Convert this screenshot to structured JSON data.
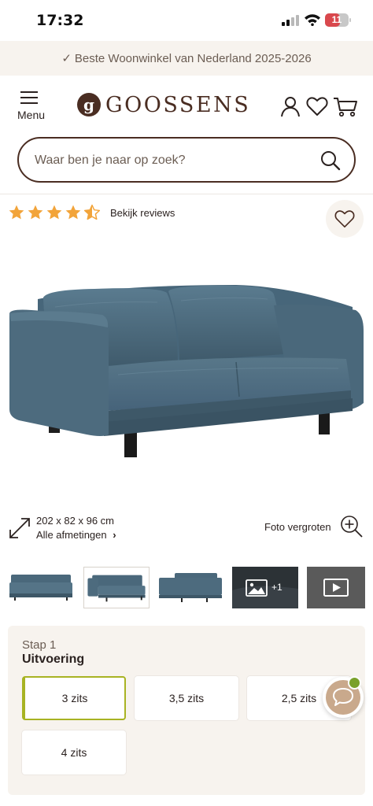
{
  "status_bar": {
    "time": "17:32",
    "battery": "11"
  },
  "announcement": {
    "check": "✓",
    "text": "Beste Woonwinkel van Nederland 2025-2026"
  },
  "header": {
    "menu_label": "Menu",
    "logo_mark": "g",
    "logo_text": "GOOSSENS",
    "icons": [
      "account-icon",
      "wishlist-icon",
      "cart-icon"
    ]
  },
  "search": {
    "placeholder": "Waar ben je naar op zoek?"
  },
  "rating": {
    "stars": 4.5,
    "max": 5,
    "link": "Bekijk reviews"
  },
  "product": {
    "dimensions": "202 x 82 x 96 cm",
    "all_dimensions": "Alle afmetingen",
    "all_dimensions_chevron": "›",
    "zoom_label": "Foto vergroten",
    "thumbnail_more": "+1"
  },
  "configurator": {
    "step": "Stap 1",
    "title": "Uitvoering",
    "options": [
      {
        "label": "3 zits",
        "selected": true
      },
      {
        "label": "3,5 zits",
        "selected": false
      },
      {
        "label": "2,5 zits",
        "selected": false
      },
      {
        "label": "4 zits",
        "selected": false
      }
    ]
  },
  "colors": {
    "brand": "#4a2d22",
    "accent_selected": "#a8b323",
    "star": "#f2a43a",
    "panel_bg": "#f7f3ee",
    "sofa": "#4d6b7e",
    "chat_online": "#7aa12b"
  }
}
